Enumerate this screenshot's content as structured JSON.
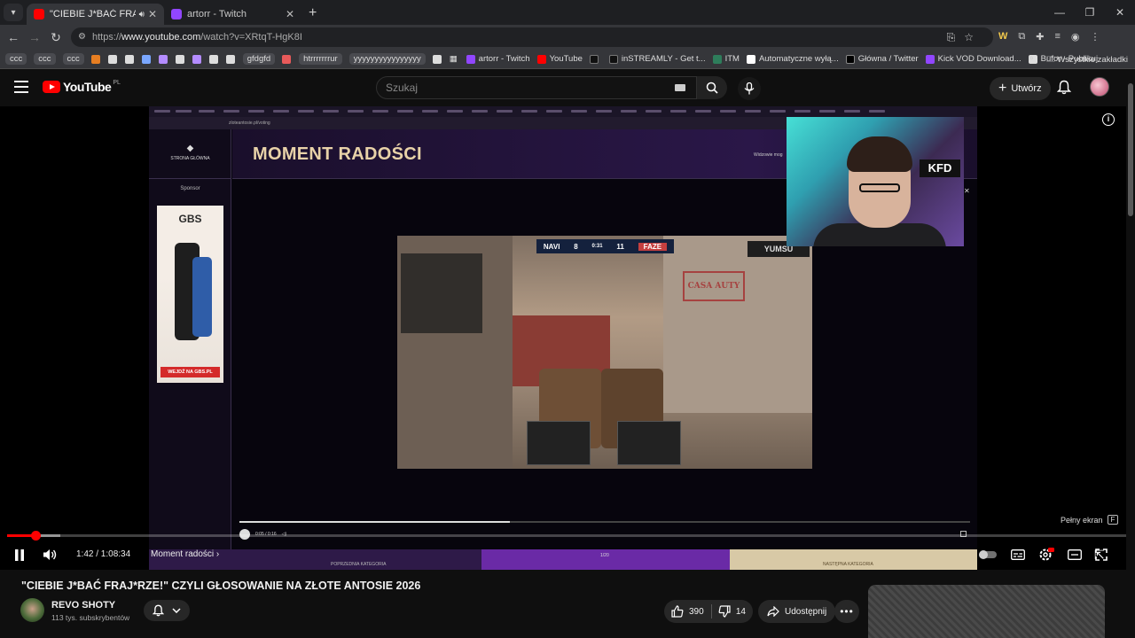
{
  "browser": {
    "tabs": [
      {
        "title": "\"CIEBIE J*BAĆ FRAJ*RZE!\" C",
        "active": true,
        "muted_icon": "speaker-icon",
        "favicon_color": "#ff0000"
      },
      {
        "title": "artorr - Twitch",
        "active": false,
        "favicon_color": "#9146ff"
      }
    ],
    "new_tab_label": "+",
    "url_prefix": "https://",
    "url_host": "www.youtube.com",
    "url_path": "/watch?v=XRtqT-HgK8I",
    "bookmarks": [
      {
        "label": "ccc",
        "type": "chip"
      },
      {
        "label": "ccc",
        "type": "chip"
      },
      {
        "label": "ccc",
        "type": "chip"
      },
      {
        "label": "gfdgfd",
        "type": "chip"
      },
      {
        "label": "htrrrrrrrur",
        "type": "chip"
      },
      {
        "label": "yyyyyyyyyyyyyyyy",
        "type": "chip"
      },
      {
        "label": "artorr - Twitch",
        "icon_color": "#9146ff"
      },
      {
        "label": "YouTube",
        "icon_color": "#ff0000"
      },
      {
        "label": "inSTREAMLY - Get t...",
        "icon_color": "#111111"
      },
      {
        "label": "ITM",
        "icon_color": "#2e7d5b"
      },
      {
        "label": "Automatyczne wyłą...",
        "icon_color": "#ffffff"
      },
      {
        "label": "Główna / Twitter",
        "icon_color": "#000000"
      },
      {
        "label": "Kick VOD Download...",
        "icon_color": "#9146ff"
      },
      {
        "label": "Bufor - Publikuj",
        "icon_color": "#dddddd"
      }
    ],
    "bookmarks_more": "»",
    "all_bookmarks": "Wszystkie zakładki"
  },
  "youtube": {
    "logo_text": "YouTube",
    "logo_country": "PL",
    "search_placeholder": "Szukaj",
    "create_label": "Utwórz"
  },
  "player": {
    "site_title": "MOMENT RADOŚCI",
    "site_home_label": "STRONA GŁÓWNA",
    "site_sponsor_label": "Sponsor",
    "ad_brand": "GBS",
    "ad_cta": "WEJDŹ NA GBS.PL",
    "site_notice": "Widzowie mog",
    "inner_url": "zloteantosie.pl/voting",
    "clip_hud_left": "NAVI",
    "clip_hud_score_left": "8",
    "clip_hud_time": "0:31",
    "clip_hud_score_right": "11",
    "clip_hud_right": "FAZE",
    "clip_brand": "YUMSU",
    "clip_sign": "CASA AUTY",
    "inner_time": "0:05 / 0:16",
    "cat_prev": "POPRZEDNIA KATEGORIA",
    "cat_next": "NASTĘPNA KATEGORIA",
    "cat_count": "1/20",
    "webcam_logo": "KFD",
    "fullscreen_hint": "Pełny ekran",
    "fullscreen_key": "F",
    "time_current": "1:42",
    "time_total": "1:08:34",
    "time_display": "1:42 / 1:08:34",
    "chapter": "Moment radości",
    "progress_fraction": 0.025
  },
  "video": {
    "title": "\"CIEBIE J*BAĆ FRAJ*RZE!\" CZYLI GŁOSOWANIE NA ZŁOTE ANTOSIE 2026",
    "channel": "REVO SHOTY",
    "subscribers": "113 tys. subskrybentów",
    "likes": "390",
    "dislikes": "14",
    "share_label": "Udostępnij"
  }
}
